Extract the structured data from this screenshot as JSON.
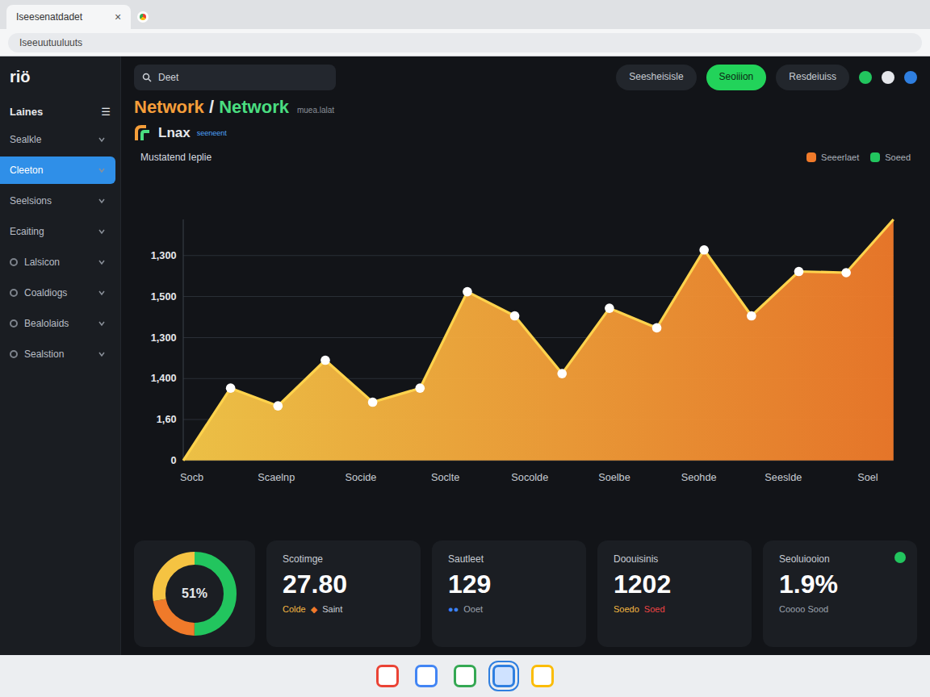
{
  "browser": {
    "tab_title": "Iseesenatdadet",
    "tab_close": "×",
    "address": "Iseeuutuuluuts"
  },
  "header_status": [
    {
      "color": "#22c55e"
    },
    {
      "color": "#e5e7eb"
    },
    {
      "color": "#2f7fe0"
    }
  ],
  "sidebar": {
    "brand": "riö",
    "header": "Laines",
    "header_icon": "☰",
    "items": [
      {
        "label": "Sealkle",
        "selected": false,
        "dot": false
      },
      {
        "label": "Cleeton",
        "selected": true,
        "dot": false
      },
      {
        "label": "Seelsions",
        "selected": false,
        "dot": false
      },
      {
        "label": "Ecaiting",
        "selected": false,
        "dot": false
      },
      {
        "label": "Lalsicon",
        "selected": false,
        "dot": true
      },
      {
        "label": "Coaldiogs",
        "selected": false,
        "dot": true
      },
      {
        "label": "Bealolaids",
        "selected": false,
        "dot": true
      },
      {
        "label": "Sealstion",
        "selected": false,
        "dot": true
      }
    ]
  },
  "search": {
    "value": "Deet"
  },
  "top_buttons": [
    {
      "label": "Seesheisisle",
      "kind": "plain"
    },
    {
      "label": "Seoiiion",
      "kind": "primary"
    },
    {
      "label": "Resdeiuiss",
      "kind": "plain"
    }
  ],
  "title": {
    "first": "Network",
    "separator": " / ",
    "second": "Network",
    "note": "muea.lalat"
  },
  "logo": {
    "name": "Lnax",
    "tagline": "seeneent"
  },
  "chart": {
    "title": "Mustatend Ieplie",
    "y_ticks": [
      "1,300",
      "1,500",
      "1,300",
      "1,400",
      "1,60",
      "0"
    ],
    "x_labels": [
      "Socb",
      "Scaelnp",
      "Socide",
      "Soclte",
      "Socolde",
      "Soelbe",
      "Seohde",
      "Seeslde",
      "Soel"
    ],
    "legend": [
      {
        "label": "Seeerlaet",
        "color": "#f07a2a"
      },
      {
        "label": "Soeed",
        "color": "#22c55e"
      }
    ],
    "series": [
      {
        "name": "Seeerlaet",
        "values": [
          0,
          600,
          453,
          832,
          484,
          600,
          1400,
          1200,
          721,
          1263,
          1100,
          1747,
          1200,
          1568,
          1558,
          2000
        ]
      }
    ]
  },
  "donut": {
    "label": "51%",
    "segments": [
      {
        "level": 0.5,
        "color": "#22c55e"
      },
      {
        "level": 0.22,
        "color": "#f07a2a"
      },
      {
        "level": 0.28,
        "color": "#f5c342"
      }
    ]
  },
  "cards": [
    {
      "title": "Scotimge",
      "value": "27.80",
      "notes": [
        {
          "text": "Colde",
          "color": "#f5b942"
        },
        {
          "text": "◆",
          "color": "#f07a2a"
        },
        {
          "text": "Saint",
          "color": "#c9ced6"
        }
      ]
    },
    {
      "title": "Sautleet",
      "value": "129",
      "notes": [
        {
          "text": "●●",
          "color": "#3b82f6"
        },
        {
          "text": "Ooet",
          "color": "#9ca3af"
        }
      ]
    },
    {
      "title": "Doouisinis",
      "value": "1202",
      "notes": [
        {
          "text": "Soedo",
          "color": "#f5b942"
        },
        {
          "text": "Soed",
          "color": "#ef4444"
        }
      ]
    },
    {
      "title": "Seoluiooion",
      "value": "1.9%",
      "dot": "#22c55e",
      "notes": [
        {
          "text": "Coooo Sood",
          "color": "#9ca3af"
        }
      ]
    }
  ],
  "taskbar": {
    "apps": [
      {
        "color": "#ea4335",
        "selected": false
      },
      {
        "color": "#4285f4",
        "selected": false
      },
      {
        "color": "#34a853",
        "selected": false
      },
      {
        "color": "#2f7fe0",
        "selected": true
      },
      {
        "color": "#fbbc05",
        "selected": false
      }
    ]
  }
}
